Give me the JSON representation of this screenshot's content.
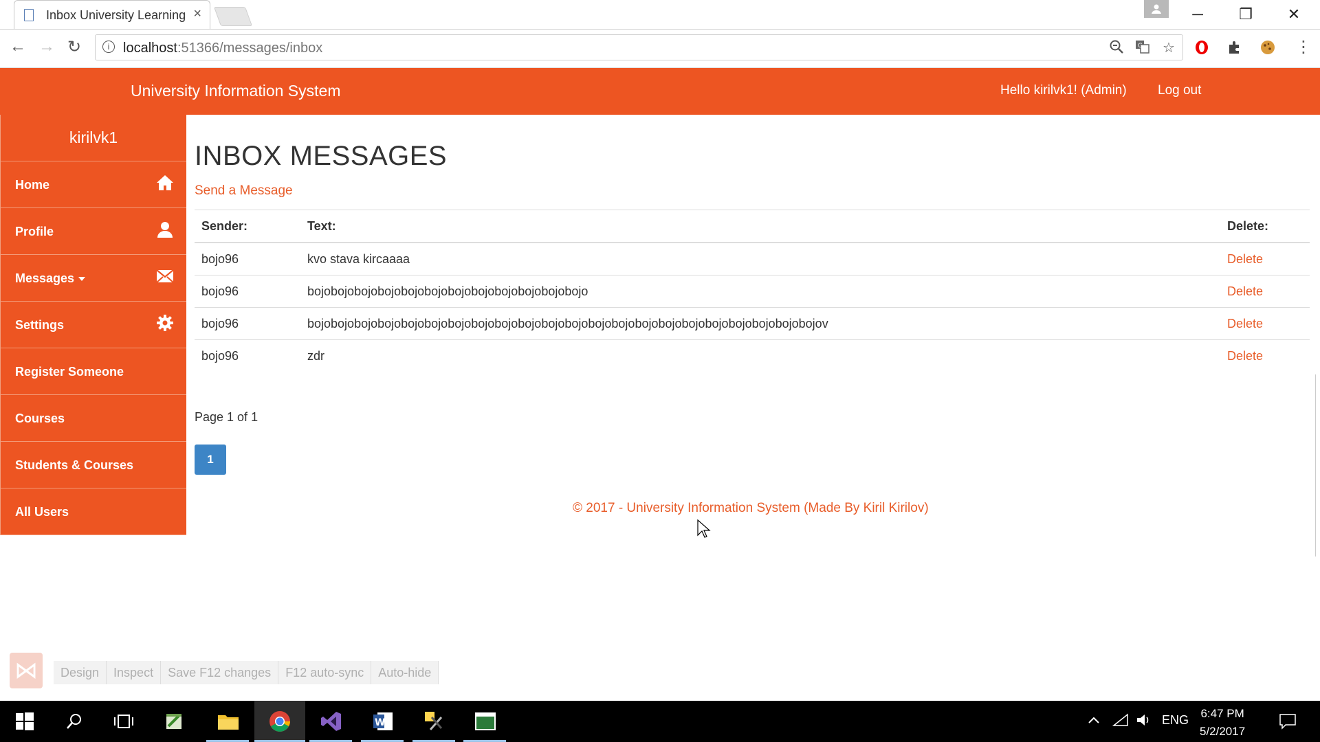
{
  "browser": {
    "tab_title": "Inbox University Learning",
    "tab_close": "×",
    "url_host": "localhost",
    "url_path": ":51366/messages/inbox",
    "profile_icon": "person-icon",
    "win_minimize": "─",
    "win_restore": "❐",
    "win_close": "✕",
    "back": "←",
    "forward": "→",
    "reload": "↻",
    "info": "i",
    "zoom_icon": "🔍",
    "star_icon": "☆",
    "menu_icon": "⋮"
  },
  "header": {
    "brand": "University Information System",
    "hello": "Hello kirilvk1! (Admin)",
    "logout": "Log out",
    "accent_color": "#ed5522"
  },
  "sidebar": {
    "username": "kirilvk1",
    "items": [
      {
        "label": "Home",
        "icon": "home-icon"
      },
      {
        "label": "Profile",
        "icon": "user-icon"
      },
      {
        "label": "Messages",
        "icon": "envelope-icon"
      },
      {
        "label": "Settings",
        "icon": "gear-icon"
      },
      {
        "label": "Register Someone"
      },
      {
        "label": "Courses"
      },
      {
        "label": "Students & Courses"
      },
      {
        "label": "All Users"
      }
    ]
  },
  "main": {
    "title": "INBOX MESSAGES",
    "send_link": "Send a Message",
    "columns": {
      "sender": "Sender:",
      "text": "Text:",
      "delete": "Delete:"
    },
    "rows": [
      {
        "sender": "bojo96",
        "text": "kvo stava kircaaaa",
        "action": "Delete"
      },
      {
        "sender": "bojo96",
        "text": "bojobojobojobojobojobojobojobojobojobojobojobojo",
        "action": "Delete"
      },
      {
        "sender": "bojo96",
        "text": "bojobojobojobojobojobojobojobojobojobojobojobojobojobojobojobojobojobojobojobojobojobojov",
        "action": "Delete"
      },
      {
        "sender": "bojo96",
        "text": "zdr",
        "action": "Delete"
      }
    ],
    "pager_text": "Page 1 of 1",
    "current_page": "1",
    "footer": "© 2017 - University Information System (Made By Kiril Kirilov)"
  },
  "vs_toolbar": {
    "items": [
      "Design",
      "Inspect",
      "Save F12 changes",
      "F12 auto-sync",
      "Auto-hide"
    ]
  },
  "taskbar": {
    "language": "ENG",
    "time": "6:47 PM",
    "date": "5/2/2017"
  }
}
